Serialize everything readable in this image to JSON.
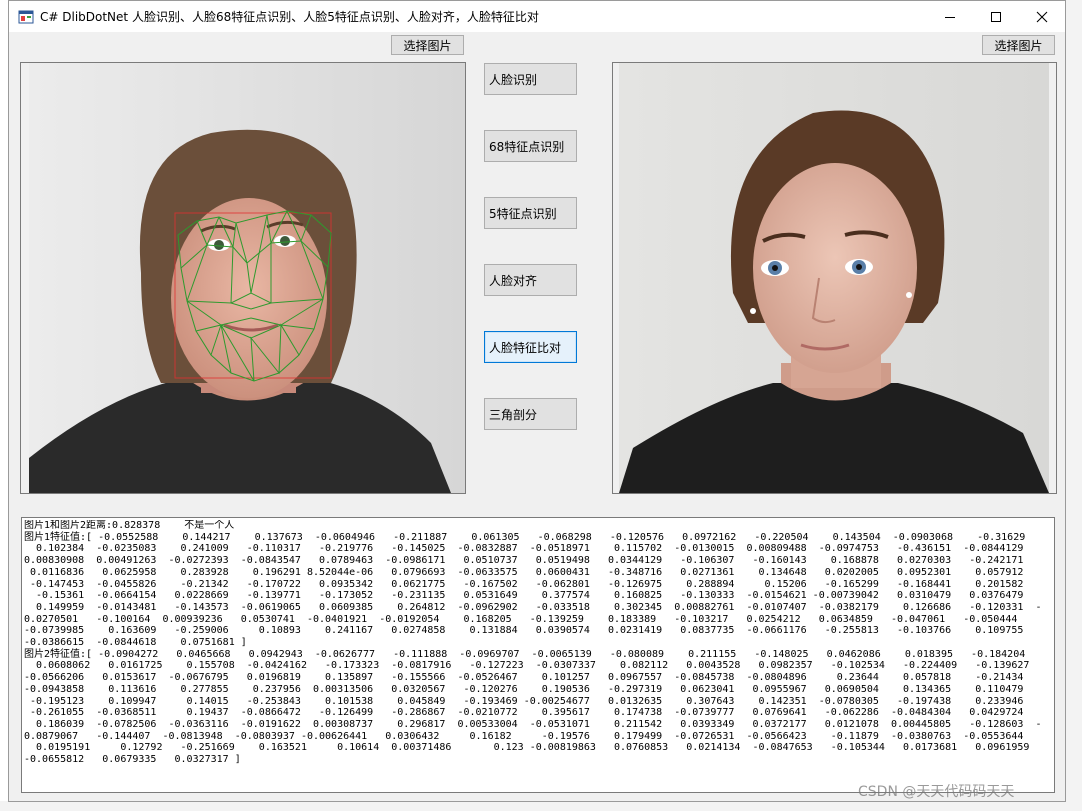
{
  "window": {
    "title": "C# DlibDotNet 人脸识别、人脸68特征点识别、人脸5特征点识别、人脸对齐，人脸特征比对"
  },
  "toolbar": {
    "left_select_label": "选择图片",
    "right_select_label": "选择图片"
  },
  "actions": [
    {
      "label": "人脸识别"
    },
    {
      "label": "68特征点识别"
    },
    {
      "label": "5特征点识别"
    },
    {
      "label": "人脸对齐"
    },
    {
      "label": "人脸特征比对"
    },
    {
      "label": "三角剖分"
    }
  ],
  "output": {
    "lines": [
      "图片1和图片2距离:0.828378    不是一个人",
      "图片1特征值:[ -0.0552588    0.144217    0.137673  -0.0604946   -0.211887    0.061305   -0.068298   -0.120576   0.0972162   -0.220504    0.143504  -0.0903068    -0.31629",
      "  0.102384  -0.0235083    0.241009   -0.110317   -0.219776   -0.145025  -0.0832887  -0.0518971    0.115702  -0.0130015  0.00809488  -0.0974753   -0.436151  -0.0844129",
      "0.00830908  0.00491263  -0.0272393  -0.0843547   0.0789463  -0.0986171   0.0510737   0.0519498   0.0344129   -0.106307   -0.160143    0.168878   0.0270303   -0.242171",
      " 0.0116836   0.0625958    0.283928    0.196291 8.52044e-06   0.0796693  -0.0633575   0.0600431   -0.348716   0.0271361    0.134648   0.0202005   0.0952301    0.057912",
      " -0.147453  -0.0455826    -0.21342   -0.170722   0.0935342   0.0621775   -0.167502   -0.062801   -0.126975    0.288894     0.15206   -0.165299   -0.168441    0.201582",
      "  -0.15361  -0.0664154   0.0228669   -0.139771   -0.173052   -0.231135   0.0531649    0.377574    0.160825   -0.130333  -0.0154621 -0.00739042   0.0310479   0.0376479",
      "  0.149959  -0.0143481   -0.143573  -0.0619065   0.0609385    0.264812  -0.0962902   -0.033518    0.302345  0.00882761  -0.0107407  -0.0382179    0.126686   -0.120331  -",
      "0.0270501   -0.100164  0.00939236   0.0530741  -0.0401921  -0.0192054    0.168205   -0.139259    0.183389   -0.103217   0.0254212   0.0634859   -0.047061   -0.050444",
      "-0.0739985    0.163609   -0.259006     0.10893    0.241167   0.0274858    0.131884   0.0390574   0.0231419   0.0837735  -0.0661176   -0.255813   -0.103766    0.109755",
      "-0.0386615  -0.0844618    0.0751681 ]",
      "图片2特征值:[ -0.0904272   0.0465668   0.0942943  -0.0626777   -0.111888  -0.0969707  -0.0065139   -0.080089    0.211155   -0.148025   0.0462086    0.018395   -0.184204",
      "  0.0608062   0.0161725    0.155708  -0.0424162   -0.173323  -0.0817916   -0.127223  -0.0307337    0.082112   0.0043528   0.0982357   -0.102534   -0.224409   -0.139627",
      "-0.0566206   0.0153617  -0.0676795   0.0196819    0.135897   -0.155566  -0.0526467    0.101257   0.0967557  -0.0845738  -0.0804896     0.23644    0.057818    -0.21434",
      "-0.0943858    0.113616    0.277855    0.237956  0.00313506   0.0320567   -0.120276    0.190536   -0.297319   0.0623041   0.0955967   0.0690504    0.134365    0.110479",
      " -0.195123    0.109947     0.14015   -0.253843    0.101538    0.045849   -0.193469 -0.00254677   0.0132635    0.307643    0.142351  -0.0780305   -0.197438    0.233946",
      " -0.261055  -0.0368511     0.19437  -0.0866472   -0.126499   -0.286867  -0.0210772    0.395617    0.174738  -0.0739777   0.0769641   -0.062286  -0.0484304   0.0429724",
      "  0.186039  -0.0782506  -0.0363116  -0.0191622  0.00308737    0.296817  0.00533004  -0.0531071    0.211542   0.0393349   0.0372177   0.0121078  0.00445805   -0.128603  -",
      "0.0879067   -0.144407  -0.0813948  -0.0803937 -0.00626441   0.0306432     0.16182     -0.19576    0.179499  -0.0726531  -0.0566423    -0.11879  -0.0380763  -0.0553644",
      "  0.0195191     0.12792   -0.251669    0.163521     0.10614  0.00371486       0.123 -0.00819863   0.0760853   0.0214134  -0.0847653   -0.105344   0.0173681   0.0961959",
      "-0.0655812   0.0679335   0.0327317 ]"
    ]
  },
  "watermark": "CSDN @天天代码码天天",
  "colors": {
    "mesh": "#2e9a2e",
    "active_border": "#0078d7"
  }
}
